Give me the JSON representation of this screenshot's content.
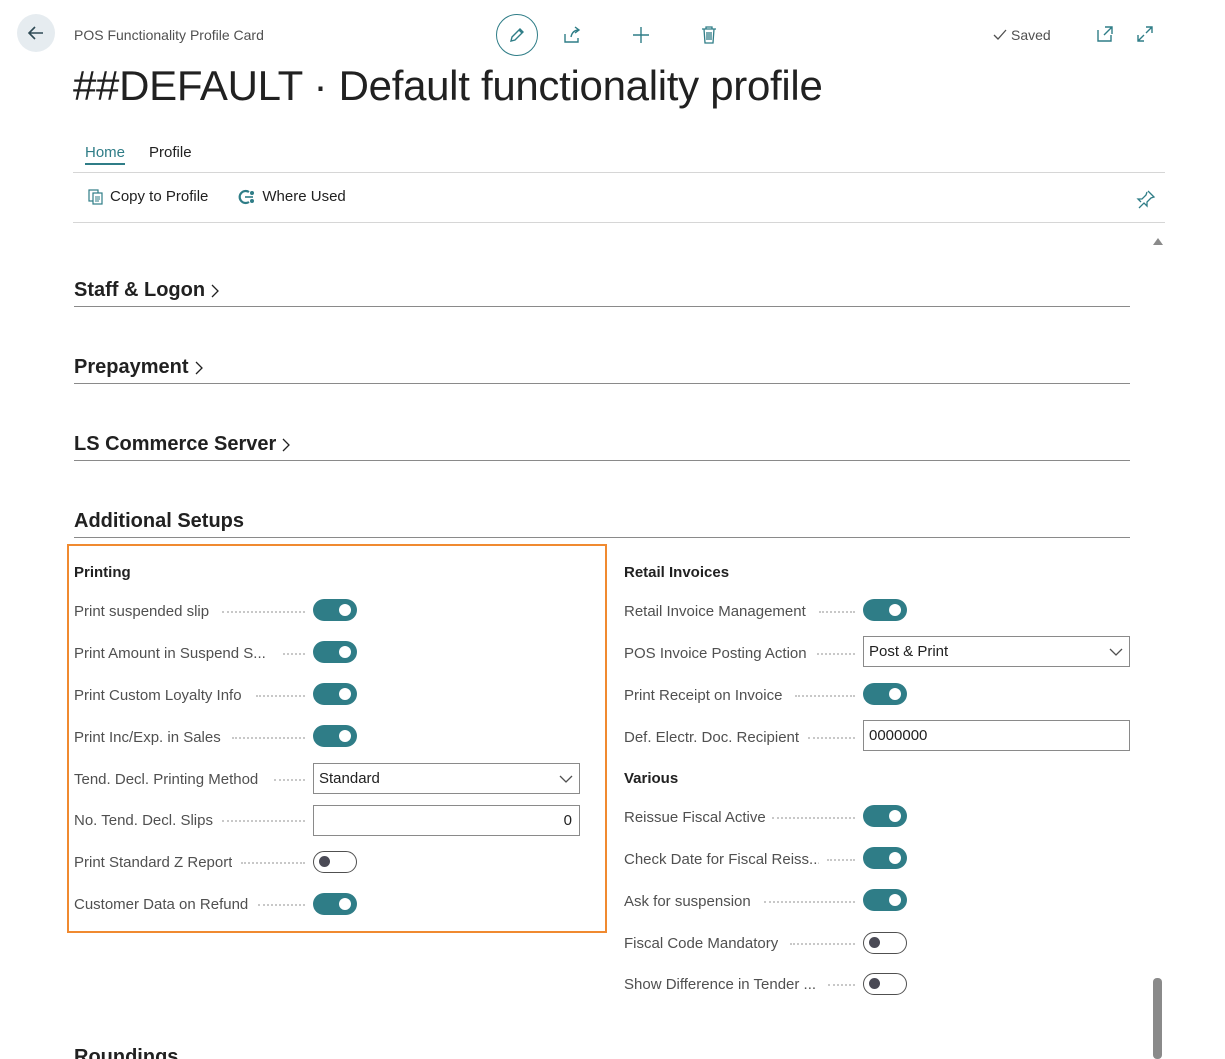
{
  "header": {
    "caption": "POS Functionality Profile Card",
    "title": "##DEFAULT · Default functionality profile",
    "saved_label": "Saved"
  },
  "tabs": [
    {
      "label": "Home",
      "active": true
    },
    {
      "label": "Profile",
      "active": false
    }
  ],
  "actions": {
    "copy_to_profile": "Copy to Profile",
    "where_used": "Where Used"
  },
  "sections": {
    "staff_logon": "Staff & Logon",
    "prepayment": "Prepayment",
    "ls_commerce_server": "LS Commerce Server",
    "additional_setups": "Additional Setups",
    "roundings": "Roundings"
  },
  "printing": {
    "title": "Printing",
    "fields": [
      {
        "label": "Print suspended slip",
        "type": "toggle",
        "on": true
      },
      {
        "label": "Print Amount in Suspend S...",
        "type": "toggle",
        "on": true
      },
      {
        "label": "Print Custom Loyalty Info",
        "type": "toggle",
        "on": true
      },
      {
        "label": "Print Inc/Exp. in Sales",
        "type": "toggle",
        "on": true
      },
      {
        "label": "Tend. Decl. Printing Method",
        "type": "select",
        "value": "Standard"
      },
      {
        "label": "No. Tend. Decl. Slips",
        "type": "number",
        "value": "0"
      },
      {
        "label": "Print Standard Z Report",
        "type": "toggle",
        "on": false
      },
      {
        "label": "Customer Data on Refund",
        "type": "toggle",
        "on": true
      }
    ]
  },
  "retail_invoices": {
    "title": "Retail Invoices",
    "fields": [
      {
        "label": "Retail Invoice Management",
        "type": "toggle",
        "on": true
      },
      {
        "label": "POS Invoice Posting Action",
        "type": "select",
        "value": "Post & Print"
      },
      {
        "label": "Print Receipt on Invoice",
        "type": "toggle",
        "on": true
      },
      {
        "label": "Def. Electr. Doc. Recipient",
        "type": "text",
        "value": "0000000"
      }
    ]
  },
  "various": {
    "title": "Various",
    "fields": [
      {
        "label": "Reissue Fiscal Active",
        "type": "toggle",
        "on": true
      },
      {
        "label": "Check Date for Fiscal Reiss...",
        "type": "toggle",
        "on": true
      },
      {
        "label": "Ask for suspension",
        "type": "toggle",
        "on": true
      },
      {
        "label": "Fiscal Code Mandatory",
        "type": "toggle",
        "on": false
      },
      {
        "label": "Show Difference in Tender ...",
        "type": "toggle",
        "on": false
      }
    ]
  },
  "colors": {
    "accent": "#2f7d87",
    "highlight": "#f08a30"
  },
  "icons": [
    "back-arrow-icon",
    "edit-pencil-icon",
    "share-icon",
    "plus-icon",
    "trash-icon",
    "checkmark-icon",
    "open-new-window-icon",
    "expand-icon",
    "copy-icon",
    "where-used-icon",
    "pin-icon",
    "chevron-right-icon",
    "chevron-down-icon"
  ]
}
